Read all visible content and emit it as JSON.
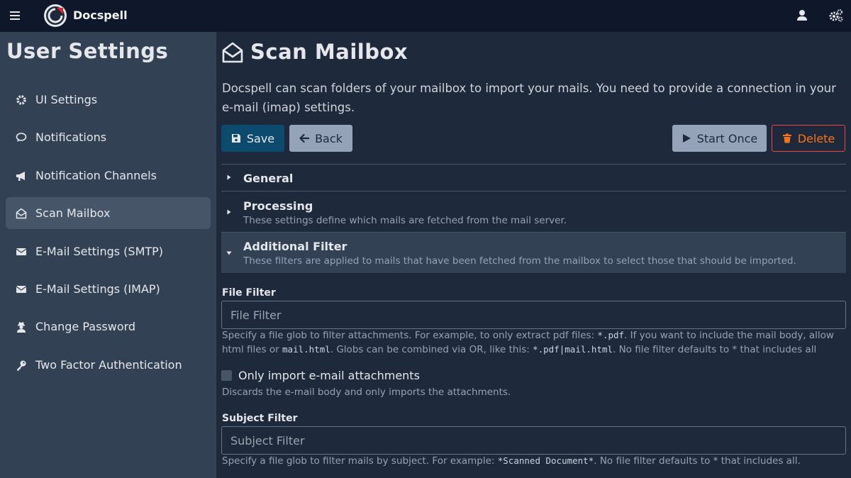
{
  "app": {
    "name": "Docspell"
  },
  "sidebar": {
    "title": "User Settings",
    "items": [
      {
        "label": "UI Settings",
        "icon": "gear-icon"
      },
      {
        "label": "Notifications",
        "icon": "comment-icon"
      },
      {
        "label": "Notification Channels",
        "icon": "bullhorn-icon"
      },
      {
        "label": "Scan Mailbox",
        "icon": "envelope-open-icon",
        "active": true
      },
      {
        "label": "E-Mail Settings (SMTP)",
        "icon": "envelope-icon"
      },
      {
        "label": "E-Mail Settings (IMAP)",
        "icon": "envelope-icon"
      },
      {
        "label": "Change Password",
        "icon": "user-secret-icon"
      },
      {
        "label": "Two Factor Authentication",
        "icon": "key-icon"
      }
    ]
  },
  "main": {
    "title": "Scan Mailbox",
    "intro": "Docspell can scan folders of your mailbox to import your mails. You need to provide a connection in your e-mail (imap) settings.",
    "buttons": {
      "save": "Save",
      "back": "Back",
      "start_once": "Start Once",
      "delete": "Delete"
    },
    "sections": {
      "general": {
        "title": "General"
      },
      "processing": {
        "title": "Processing",
        "desc": "These settings define which mails are fetched from the mail server."
      },
      "additional_filter": {
        "title": "Additional Filter",
        "desc": "These filters are applied to mails that have been fetched from the mailbox to select those that should be imported."
      }
    },
    "file_filter": {
      "label": "File Filter",
      "placeholder": "File Filter",
      "value": "",
      "help": {
        "p1": "Specify a file glob to filter attachments. For example, to only extract pdf files: ",
        "c1": "*.pdf",
        "p2": ". If you want to include the mail body, allow html files or ",
        "c2": "mail.html",
        "p3": ". Globs can be combined via OR, like this: ",
        "c3": "*.pdf|mail.html",
        "p4": ". No file filter defaults to * that includes all"
      }
    },
    "attachments_only": {
      "label": "Only import e-mail attachments",
      "checked": false,
      "help": "Discards the e-mail body and only imports the attachments."
    },
    "subject_filter": {
      "label": "Subject Filter",
      "placeholder": "Subject Filter",
      "value": "",
      "help": {
        "p1": "Specify a file glob to filter mails by subject. For example: ",
        "c1": "*Scanned Document*",
        "p2": ". No file filter defaults to * that includes all."
      }
    }
  },
  "colors": {
    "topbar": "#0f172a",
    "sidebar": "#334155",
    "background": "#1e293b",
    "primary_button": "#0c4a6e",
    "secondary_button": "#94a3b8",
    "delete": "#f97316"
  }
}
